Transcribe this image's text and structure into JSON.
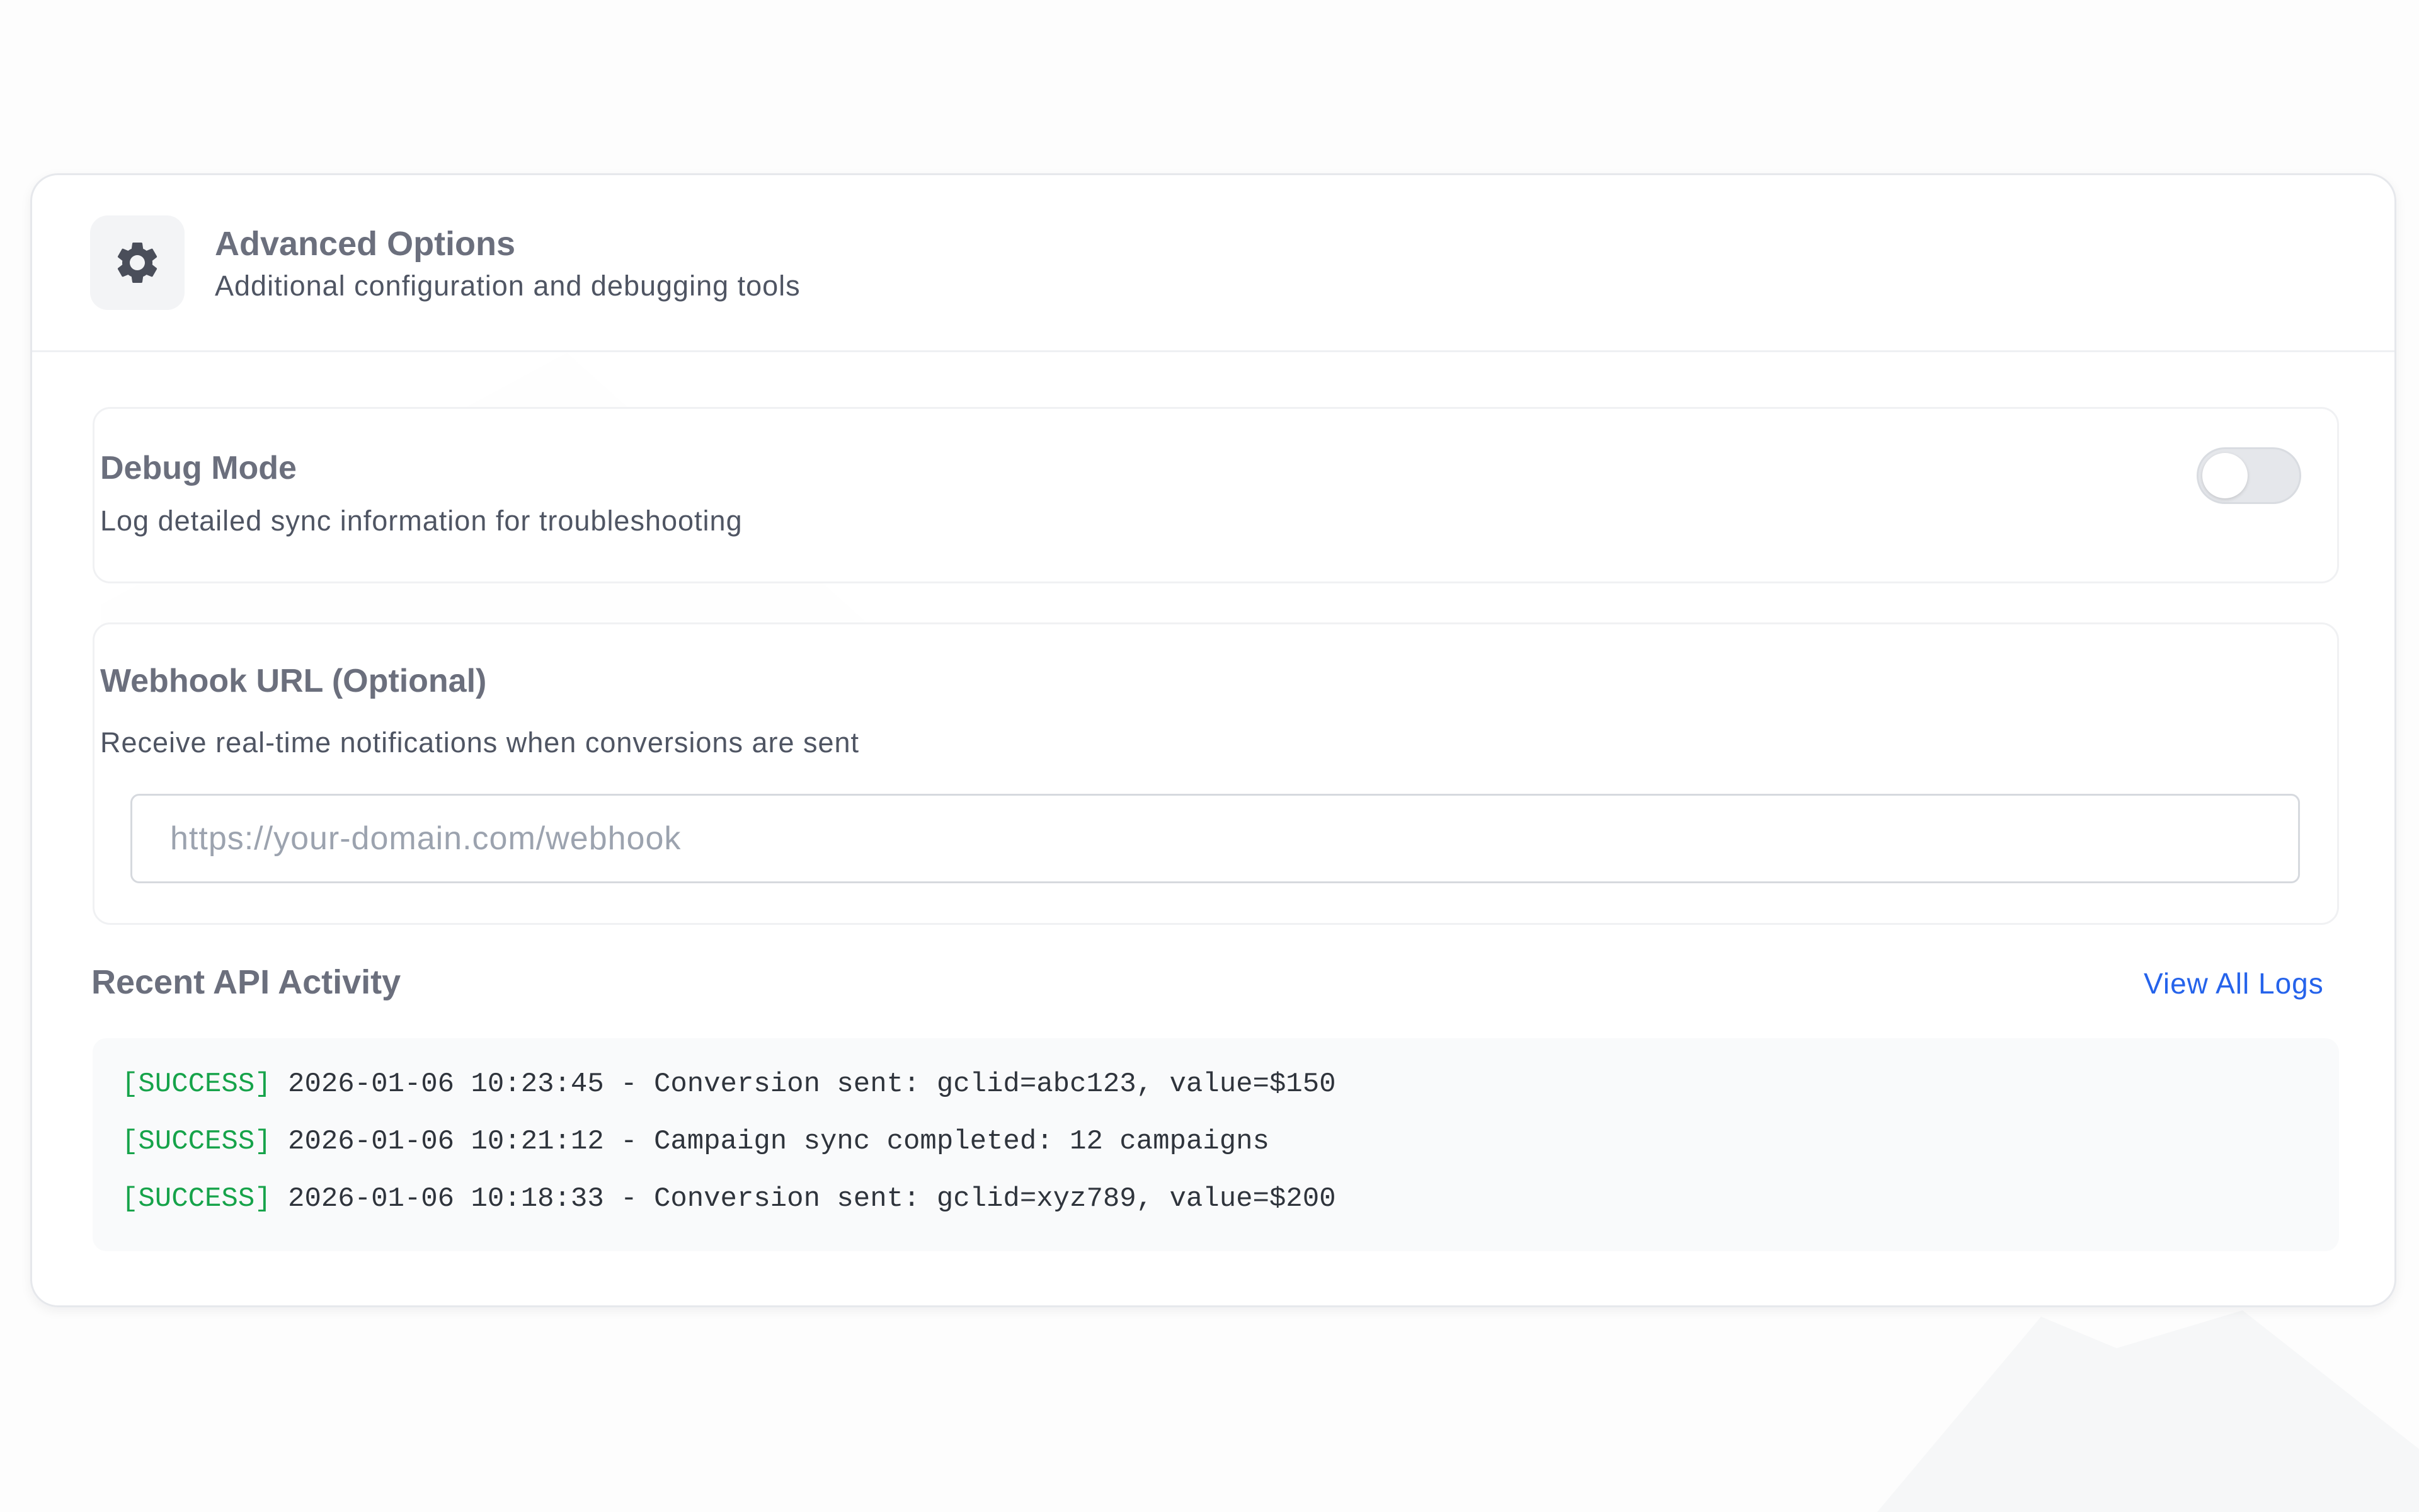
{
  "header": {
    "icon": "gear-icon",
    "title": "Advanced Options",
    "subtitle": "Additional configuration and debugging tools"
  },
  "debug": {
    "title": "Debug Mode",
    "description": "Log detailed sync information for troubleshooting",
    "enabled": false
  },
  "webhook": {
    "title": "Webhook URL (Optional)",
    "description": "Receive real-time notifications when conversions are sent",
    "value": "",
    "placeholder": "https://your-domain.com/webhook"
  },
  "activity": {
    "title": "Recent API Activity",
    "view_all_label": "View All Logs",
    "logs": [
      {
        "status": "[SUCCESS]",
        "message": "2026-01-06 10:23:45 - Conversion sent: gclid=abc123, value=$150"
      },
      {
        "status": "[SUCCESS]",
        "message": "2026-01-06 10:21:12 - Campaign sync completed: 12 campaigns"
      },
      {
        "status": "[SUCCESS]",
        "message": "2026-01-06 10:18:33 - Conversion sent: gclid=xyz789, value=$200"
      }
    ]
  },
  "colors": {
    "success": "#16a34a",
    "link": "#2563eb",
    "title_text": "#6b6f7d",
    "body_text": "#4f5563"
  }
}
